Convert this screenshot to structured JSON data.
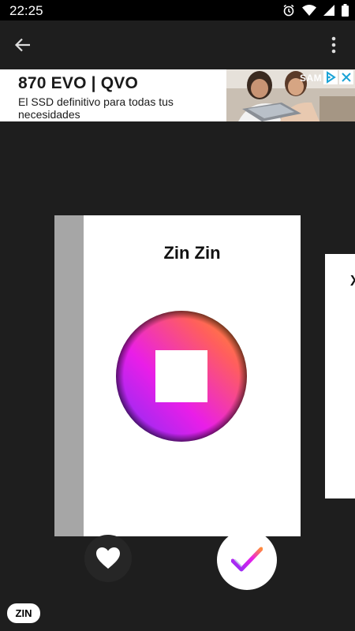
{
  "status_bar": {
    "time": "22:25",
    "icons": [
      "alarm-icon",
      "wifi-icon",
      "signal-icon",
      "battery-icon"
    ]
  },
  "app_bar": {
    "back_icon": "arrow-left-icon",
    "menu_icon": "more-vert-icon"
  },
  "ad": {
    "headline": "870 EVO | QVO",
    "body": "El SSD definitivo para todas tus necesidades",
    "brand": "SAM",
    "choices_icon": "ad-choices-icon",
    "close_icon": "close-icon"
  },
  "card": {
    "title": "Zin Zin",
    "logo_icon": "gradient-circle-stop-icon"
  },
  "next_card": {
    "partial_text": "X"
  },
  "actions": {
    "like_icon": "heart-icon",
    "done_icon": "checkmark-icon"
  },
  "badge": {
    "label": "ZIN"
  },
  "colors": {
    "background": "#1e1e1e",
    "status_bar": "#000000",
    "spine": "#a6a6a6",
    "logo_gradient": [
      "#7b2ff7",
      "#e91ee8",
      "#ff6a3d",
      "#ff9a1f"
    ]
  }
}
